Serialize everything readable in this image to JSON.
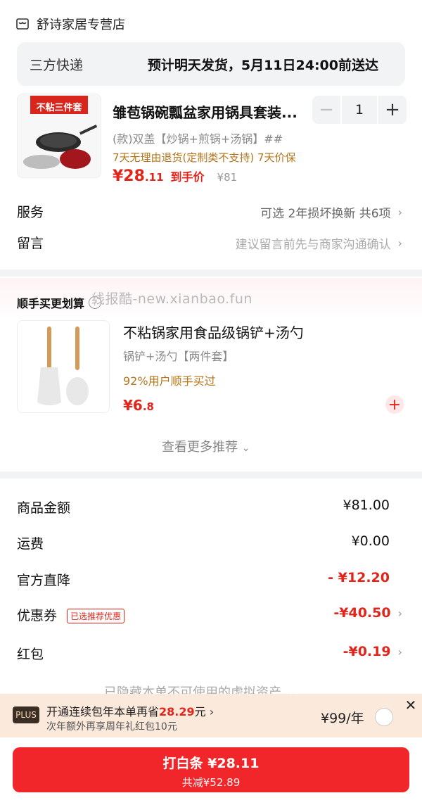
{
  "store": {
    "name": "舒诗家居专营店",
    "icon": "store-icon"
  },
  "shipping": {
    "method": "三方快递",
    "eta": "预计明天发货，5月11日24:00前送达"
  },
  "product": {
    "title": "雏苞锅碗瓢盆家用锅具套装...",
    "spec": "(款)双盖【炒锅+煎锅+汤锅】##",
    "policy": "7天无理由退货(定制类不支持) 7天价保",
    "price_int": "¥28",
    "price_dec": ".11",
    "price_tag": "到手价",
    "orig_price": "¥81",
    "quantity": "1",
    "image_label": "不粘三件套"
  },
  "service": {
    "label": "服务",
    "value": "可选 2年损坏换新 共6项"
  },
  "message": {
    "label": "留言",
    "placeholder": "建议留言前先与商家沟通确认"
  },
  "addon": {
    "section_title": "顺手买更划算",
    "watermark": "线报酷-new.xianbao.fun",
    "name": "不粘锅家用食品级锅铲+汤勺",
    "spec": "锅铲+汤勺【两件套】",
    "bought": "92%用户顺手买过",
    "price_int": "¥6",
    "price_dec": ".8",
    "more": "查看更多推荐"
  },
  "summary": {
    "goods": {
      "label": "商品金额",
      "value": "¥81.00"
    },
    "freight": {
      "label": "运费",
      "value": "¥0.00"
    },
    "official": {
      "label": "官方直降",
      "value": "- ¥12.20"
    },
    "coupon": {
      "label": "优惠券",
      "badge": "已选推荐优惠",
      "value": "-¥40.50"
    },
    "redpacket": {
      "label": "红包",
      "value": "-¥0.19"
    },
    "hidden": "已隐藏本单不可使用的虚拟资产"
  },
  "plus": {
    "tag": "PLUS",
    "main_prefix": "开通连续包年本单再省",
    "main_amount": "28.29",
    "main_suffix": "元",
    "sub": "次年额外再享周年礼红包10元",
    "price": "¥99/年"
  },
  "pay": {
    "main": "打白条 ¥28.11",
    "sub": "共减¥52.89"
  },
  "colors": {
    "accent": "#e1251b",
    "button": "#f0262a",
    "gold": "#b5761b"
  }
}
